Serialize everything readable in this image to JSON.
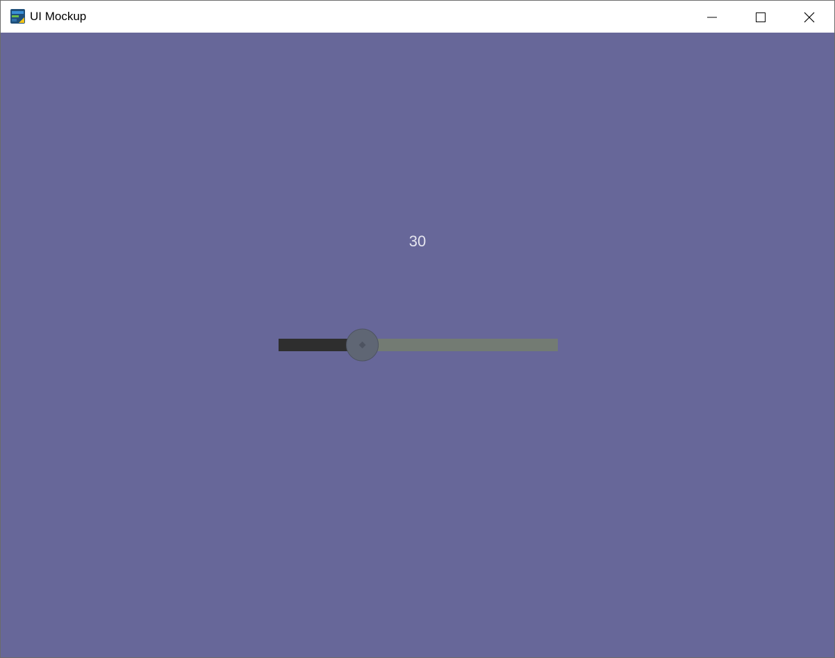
{
  "window": {
    "title": "UI Mockup",
    "controls": [
      "minimize-icon",
      "maximize-icon",
      "close-icon"
    ]
  },
  "colors": {
    "background": "#676799",
    "titlebar": "#ffffff",
    "track_filled": "#2e2e2e",
    "track_empty": "#737b73",
    "thumb": "#5f6674",
    "thumb_border": "#4d5360",
    "label_text": "#e6e6ef"
  },
  "slider": {
    "value": "30",
    "min": 0,
    "max": 100,
    "fraction": 0.3
  }
}
